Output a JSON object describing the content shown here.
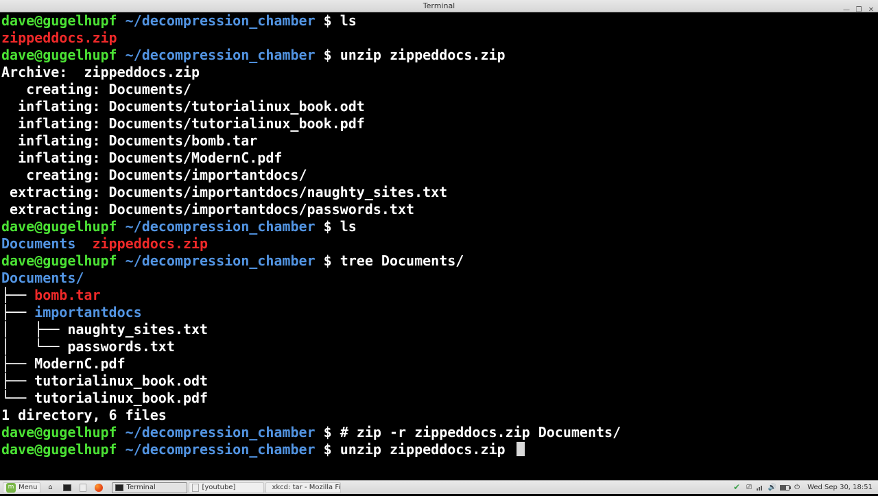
{
  "window": {
    "title": "Terminal"
  },
  "prompt": {
    "user": "dave@gugelhupf",
    "path": "~/decompression_chamber",
    "symbol": "$"
  },
  "session": [
    {
      "t": "prompt",
      "cmd": "ls"
    },
    {
      "t": "out-red",
      "text": "zippeddocs.zip"
    },
    {
      "t": "prompt",
      "cmd": "unzip zippeddocs.zip"
    },
    {
      "t": "out",
      "text": "Archive:  zippeddocs.zip"
    },
    {
      "t": "out",
      "text": "   creating: Documents/"
    },
    {
      "t": "out",
      "text": "  inflating: Documents/tutorialinux_book.odt  "
    },
    {
      "t": "out",
      "text": "  inflating: Documents/tutorialinux_book.pdf  "
    },
    {
      "t": "out",
      "text": "  inflating: Documents/bomb.tar  "
    },
    {
      "t": "out",
      "text": "  inflating: Documents/ModernC.pdf  "
    },
    {
      "t": "out",
      "text": "   creating: Documents/importantdocs/"
    },
    {
      "t": "out",
      "text": " extracting: Documents/importantdocs/naughty_sites.txt  "
    },
    {
      "t": "out",
      "text": " extracting: Documents/importantdocs/passwords.txt  "
    },
    {
      "t": "prompt",
      "cmd": "ls"
    },
    {
      "t": "ls2",
      "dir": "Documents",
      "file": "zippeddocs.zip"
    },
    {
      "t": "prompt",
      "cmd": "tree Documents/"
    },
    {
      "t": "out-blue",
      "text": "Documents/"
    },
    {
      "t": "tree",
      "prefix": "├── ",
      "name": "bomb.tar",
      "color": "red"
    },
    {
      "t": "tree",
      "prefix": "├── ",
      "name": "importantdocs",
      "color": "blue"
    },
    {
      "t": "tree",
      "prefix": "│   ├── ",
      "name": "naughty_sites.txt",
      "color": "white"
    },
    {
      "t": "tree",
      "prefix": "│   └── ",
      "name": "passwords.txt",
      "color": "white"
    },
    {
      "t": "tree",
      "prefix": "├── ",
      "name": "ModernC.pdf",
      "color": "white"
    },
    {
      "t": "tree",
      "prefix": "├── ",
      "name": "tutorialinux_book.odt",
      "color": "white"
    },
    {
      "t": "tree",
      "prefix": "└── ",
      "name": "tutorialinux_book.pdf",
      "color": "white"
    },
    {
      "t": "out",
      "text": ""
    },
    {
      "t": "out",
      "text": "1 directory, 6 files"
    },
    {
      "t": "prompt",
      "cmd": "# zip -r zippeddocs.zip Documents/"
    },
    {
      "t": "prompt",
      "cmd": "unzip zippeddocs.zip ",
      "cursor": true
    }
  ],
  "taskbar": {
    "menu": "Menu",
    "tasks": [
      {
        "label": "Terminal",
        "icon": "term",
        "active": true
      },
      {
        "label": "[youtube]",
        "icon": "file"
      },
      {
        "label": "xkcd: tar - Mozilla Fire…",
        "icon": "ff"
      }
    ],
    "clock": "Wed Sep 30, 18:51"
  }
}
